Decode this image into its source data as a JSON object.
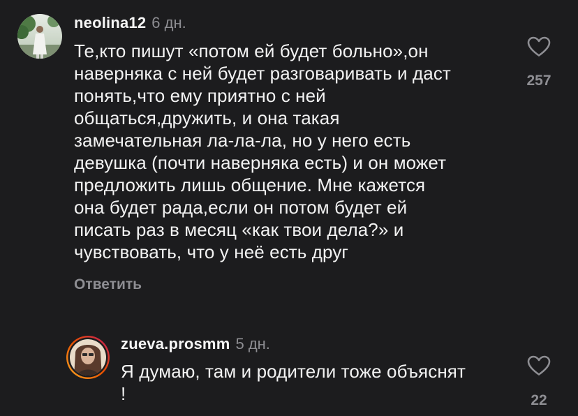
{
  "comments": [
    {
      "username": "neolina12",
      "time": "6 дн.",
      "text": "Те,кто пишут «потом ей будет больно»,он\nнаверняка с ней будет разговаривать и даст\nпонять,что ему приятно с ней\nобщаться,дружить, и она такая\nзамечательная ла-ла-ла, но у него есть\nдевушка (почти наверняка есть) и он может\nпредложить лишь общение. Мне кажется\nона будет рада,если он потом будет ей\nписать раз в месяц «как твои дела?» и\nчувствовать, что у неё есть друг",
      "reply_label": "Ответить",
      "likes": "257"
    },
    {
      "username": "zueva.prosmm",
      "time": "5 дн.",
      "text": "Я думаю, там и родители тоже объяснят\n!",
      "likes": "22"
    }
  ],
  "colors": {
    "background": "#1c1c1e",
    "text": "#f2f2f2",
    "muted": "#8e8e93",
    "story_ring_start": "#f9a825",
    "story_ring_end": "#c2185b"
  }
}
